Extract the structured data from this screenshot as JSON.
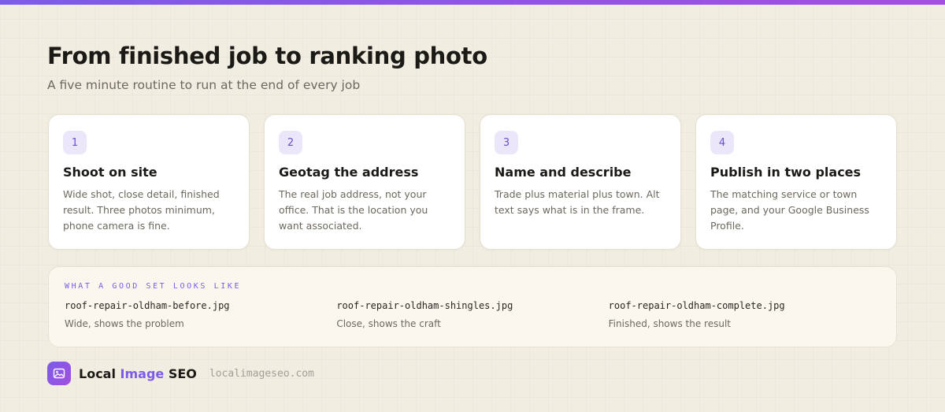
{
  "header": {
    "title": "From finished job to ranking photo",
    "subtitle": "A five minute routine to run at the end of every job"
  },
  "steps": [
    {
      "number": "1",
      "title": "Shoot on site",
      "description": "Wide shot, close detail, finished result. Three photos minimum, phone camera is fine."
    },
    {
      "number": "2",
      "title": "Geotag the address",
      "description": "The real job address, not your office. That is the location you want associated."
    },
    {
      "number": "3",
      "title": "Name and describe",
      "description": "Trade plus material plus town. Alt text says what is in the frame."
    },
    {
      "number": "4",
      "title": "Publish in two places",
      "description": "The matching service or town page, and your Google Business Profile."
    }
  ],
  "examples": {
    "label": "WHAT A GOOD SET LOOKS LIKE",
    "items": [
      {
        "filename": "roof-repair-oldham-before.jpg",
        "note": "Wide, shows the problem"
      },
      {
        "filename": "roof-repair-oldham-shingles.jpg",
        "note": "Close, shows the craft"
      },
      {
        "filename": "roof-repair-oldham-complete.jpg",
        "note": "Finished, shows the result"
      }
    ]
  },
  "brand": {
    "name_part1": "Local",
    "name_part2": "Image",
    "name_part3": "SEO",
    "domain": "localimageseo.com",
    "icon": "image-icon"
  },
  "colors": {
    "accent": "#7b5ce8",
    "accent_end": "#a34ee0",
    "background": "#f1ede1",
    "card": "#ffffff",
    "step_badge_bg": "#ece6fb"
  }
}
